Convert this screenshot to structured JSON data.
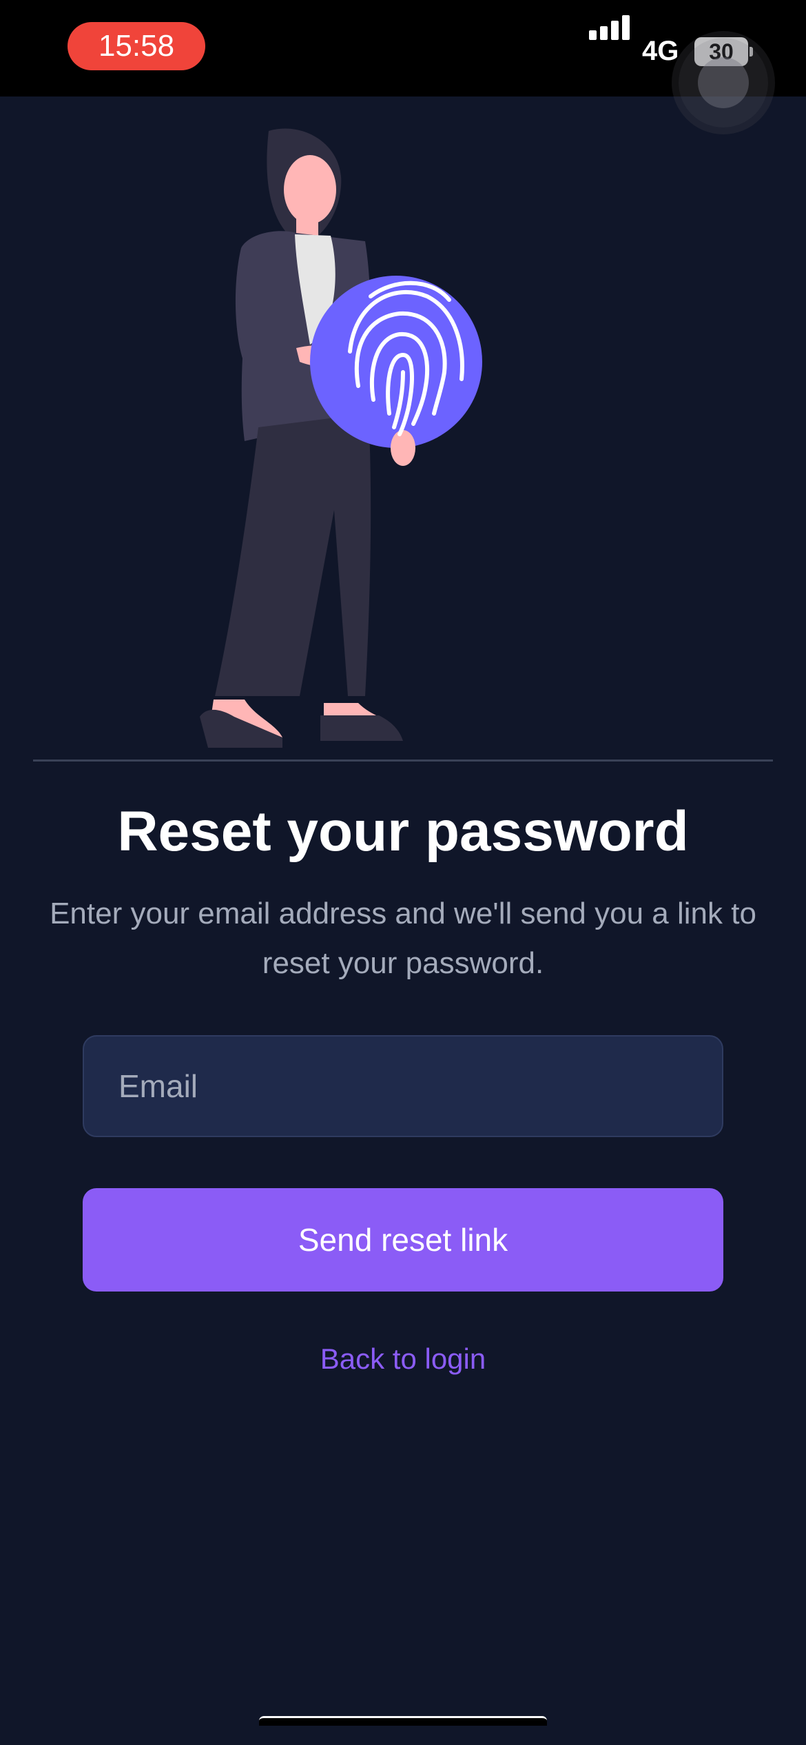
{
  "status_bar": {
    "time": "15:58",
    "network": "4G",
    "battery": "30",
    "icons": [
      "signal-icon",
      "battery-icon"
    ]
  },
  "reset": {
    "title": "Reset your password",
    "subtitle": "Enter your email address and we'll send you a link to reset your password.",
    "email_placeholder": "Email",
    "email_value": "",
    "send_button_label": "Send reset link",
    "back_link_label": "Back to login"
  },
  "illustration": {
    "name": "person-holding-fingerprint",
    "icon": "fingerprint-icon"
  },
  "colors": {
    "background": "#101629",
    "accent": "#8b5cf6",
    "input_background": "#1f2a4b",
    "status_time_pill": "#f0443a",
    "fingerprint_circle": "#6c63ff"
  }
}
